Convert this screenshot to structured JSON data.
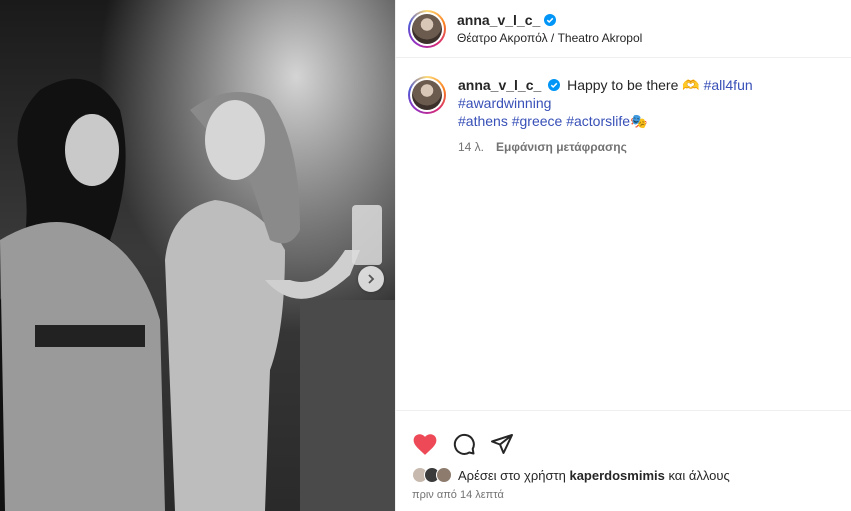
{
  "post": {
    "username": "anna_v_l_c_",
    "location": "Θέατρο Ακροπόλ / Theatro Akropol"
  },
  "caption": {
    "username": "anna_v_l_c_",
    "text": "Happy to be there 🫶",
    "hashtags_line1": "#all4fun #awardwinning",
    "hashtags_line2": "#athens #greece #actorslife🎭",
    "age": "14 λ.",
    "translate": "Εμφάνιση μετάφρασης"
  },
  "likes": {
    "prefix": "Αρέσει στο χρήστη",
    "user": "kaperdosmimis",
    "suffix": "και άλλους"
  },
  "timestamp": "πριν από 14 λεπτά",
  "colors": {
    "like": "#ed4956",
    "hashtag": "#3850b7",
    "verified": "#0095f6"
  },
  "icons": [
    "heart-icon",
    "comment-icon",
    "share-icon",
    "verified-badge-icon",
    "chevron-right-icon"
  ]
}
